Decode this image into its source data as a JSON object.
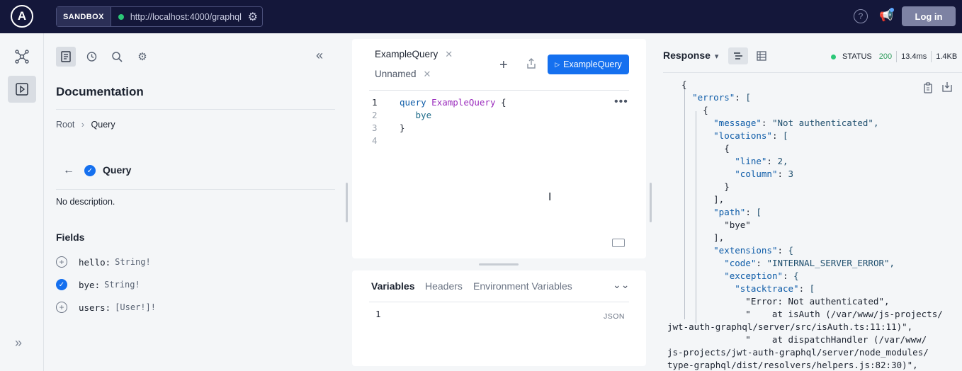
{
  "topbar": {
    "logo_letter": "A",
    "sandbox_label": "SANDBOX",
    "endpoint_url": "http://localhost:4000/graphql",
    "login_label": "Log in"
  },
  "docs": {
    "title": "Documentation",
    "breadcrumb": [
      "Root",
      "Query"
    ],
    "type_title": "Query",
    "description": "No description.",
    "fields_heading": "Fields",
    "fields": [
      {
        "name": "hello:",
        "type": "String!",
        "selected": false
      },
      {
        "name": "bye:",
        "type": "String!",
        "selected": true
      },
      {
        "name": "users:",
        "type": "[User!]!",
        "selected": false
      }
    ]
  },
  "editor": {
    "tabs": [
      {
        "label": "ExampleQuery",
        "active": true
      },
      {
        "label": "Unnamed",
        "active": false
      }
    ],
    "run_label": "ExampleQuery",
    "lines": [
      {
        "num": "1",
        "keyword": "query",
        "name": "ExampleQuery",
        "rest": "{"
      },
      {
        "num": "2",
        "text": "bye"
      },
      {
        "num": "3",
        "text": "}"
      },
      {
        "num": "4",
        "text": ""
      }
    ]
  },
  "variables": {
    "tabs": [
      "Variables",
      "Headers",
      "Environment Variables"
    ],
    "line_number": "1",
    "format_label": "JSON"
  },
  "response": {
    "title": "Response",
    "status_label": "STATUS",
    "status_code": "200",
    "time": "13.4ms",
    "size": "1.4KB",
    "json_lines": [
      "{",
      "  \"errors\": [",
      "    {",
      "      \"message\": \"Not authenticated\",",
      "      \"locations\": [",
      "        {",
      "          \"line\": 2,",
      "          \"column\": 3",
      "        }",
      "      ],",
      "      \"path\": [",
      "        \"bye\"",
      "      ],",
      "      \"extensions\": {",
      "        \"code\": \"INTERNAL_SERVER_ERROR\",",
      "        \"exception\": {",
      "          \"stacktrace\": [",
      "            \"Error: Not authenticated\",",
      "            \"    at isAuth (/var/www/js-projects/",
      "jwt-auth-graphql/server/src/isAuth.ts:11:11)\",",
      "            \"    at dispatchHandler (/var/www/",
      "js-projects/jwt-auth-graphql/server/node_modules/",
      "type-graphql/dist/resolvers/helpers.js:82:30)\","
    ]
  },
  "colors": {
    "topbar": "#14173a",
    "accent": "#1570ef",
    "status_ok": "#2bc777"
  }
}
